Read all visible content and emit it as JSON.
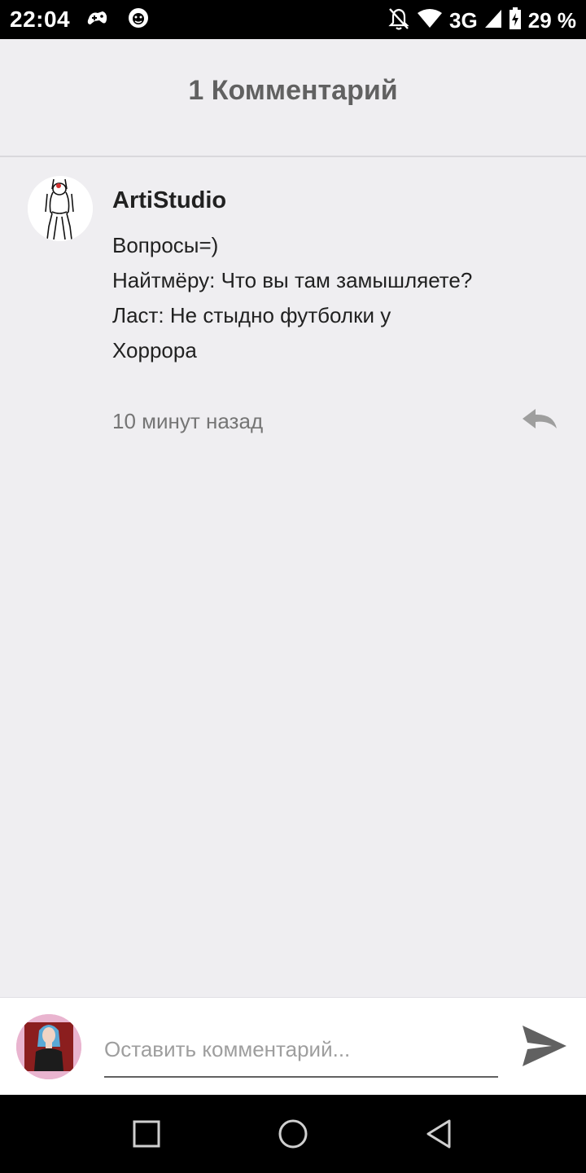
{
  "status_bar": {
    "time": "22:04",
    "network": "3G",
    "battery": "29 %",
    "icons": [
      "gamepad-icon",
      "lion-badge-icon",
      "notifications-off-icon",
      "wifi-icon",
      "signal-icon",
      "battery-charging-icon"
    ]
  },
  "header": {
    "title": "1 Комментарий"
  },
  "comment": {
    "author": "ArtiStudio",
    "lines": [
      "Вопросы=)",
      "Найтмёру: Что вы там замышляете?",
      "Ласт: Не стыдно футболки у",
      "Хоррора"
    ],
    "time_ago": "10 минут назад",
    "reply_icon": "reply-icon"
  },
  "input_bar": {
    "placeholder": "Оставить комментарий...",
    "value": "",
    "send_icon": "send-icon"
  },
  "nav_bar": {
    "icons": [
      "recents-icon",
      "home-icon",
      "back-icon"
    ]
  },
  "colors": {
    "background": "#efeef1",
    "header_text": "#616161",
    "body_text": "#212121",
    "muted_text": "#757575",
    "icon_gray": "#9e9e9e",
    "send_icon": "#616161",
    "status_bar": "#000000",
    "avatar_ring": "#e9b4cf"
  }
}
